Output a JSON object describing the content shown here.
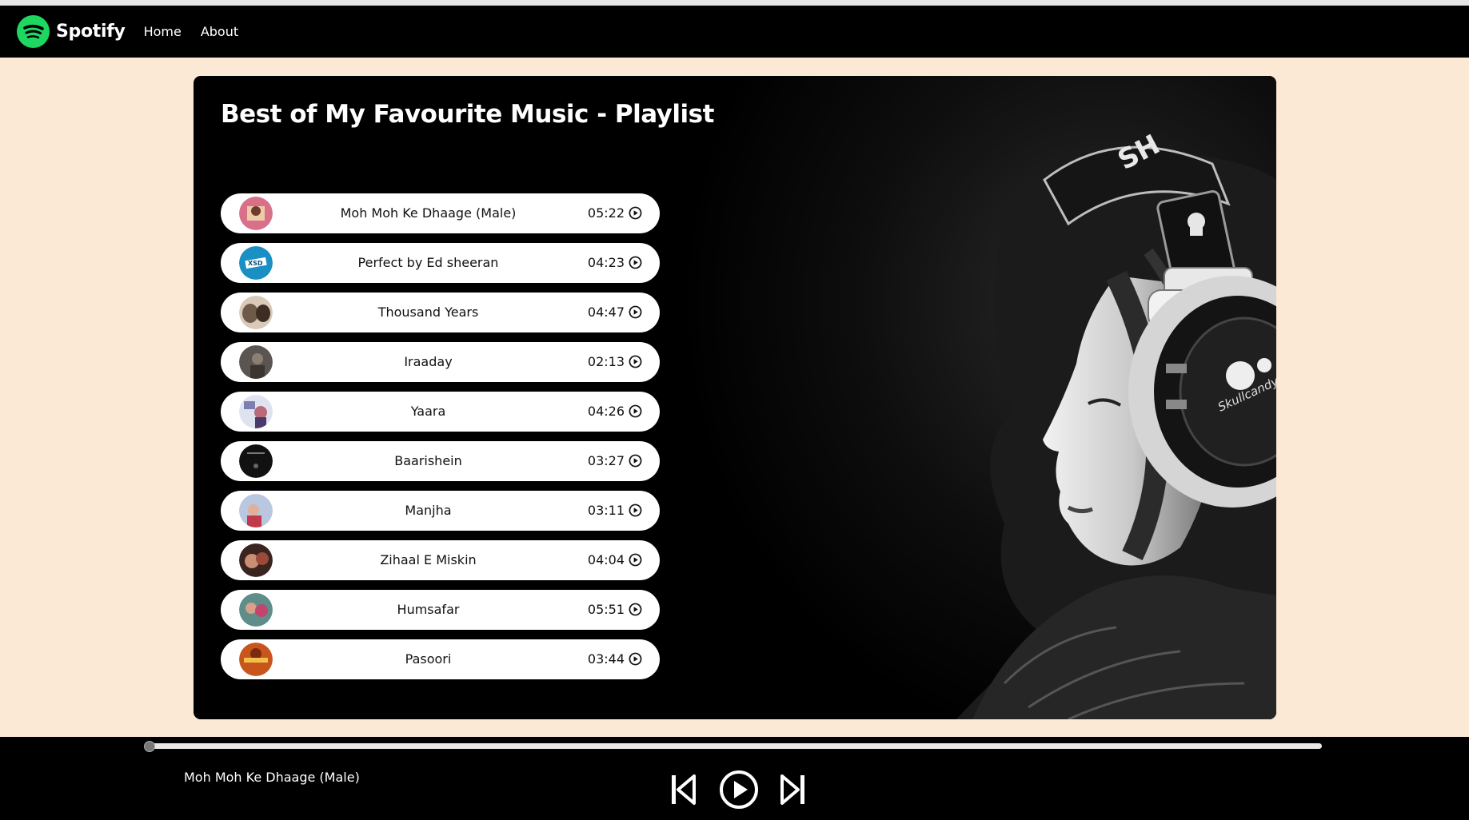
{
  "navbar": {
    "brand": "Spotify",
    "links": [
      "Home",
      "About"
    ]
  },
  "playlist": {
    "title": "Best of My Favourite Music - Playlist",
    "songs": [
      {
        "name": "Moh Moh Ke Dhaage (Male)",
        "duration": "05:22",
        "thumb": "#d9708a"
      },
      {
        "name": "Perfect by Ed sheeran",
        "duration": "04:23",
        "thumb": "#1a8fc4"
      },
      {
        "name": "Thousand Years",
        "duration": "04:47",
        "thumb": "#6d5a48"
      },
      {
        "name": "Iraaday",
        "duration": "02:13",
        "thumb": "#5a5550"
      },
      {
        "name": "Yaara",
        "duration": "04:26",
        "thumb": "#7c7fb0"
      },
      {
        "name": "Baarishein",
        "duration": "03:27",
        "thumb": "#111111"
      },
      {
        "name": "Manjha",
        "duration": "03:11",
        "thumb": "#b9c7e0"
      },
      {
        "name": "Zihaal E Miskin",
        "duration": "04:04",
        "thumb": "#9b4a3a"
      },
      {
        "name": "Humsafar",
        "duration": "05:51",
        "thumb": "#5f8d8a"
      },
      {
        "name": "Pasoori",
        "duration": "03:44",
        "thumb": "#c8561c"
      }
    ]
  },
  "player": {
    "now_playing": "Moh Moh Ke Dhaage (Male)",
    "progress": 0
  },
  "icons": {
    "play": "play-circle-icon",
    "previous": "skip-previous-icon",
    "next": "skip-next-icon"
  },
  "colors": {
    "brand": "#1ed760",
    "page_bg": "#fbe9d6",
    "bar_bg": "#000000"
  }
}
